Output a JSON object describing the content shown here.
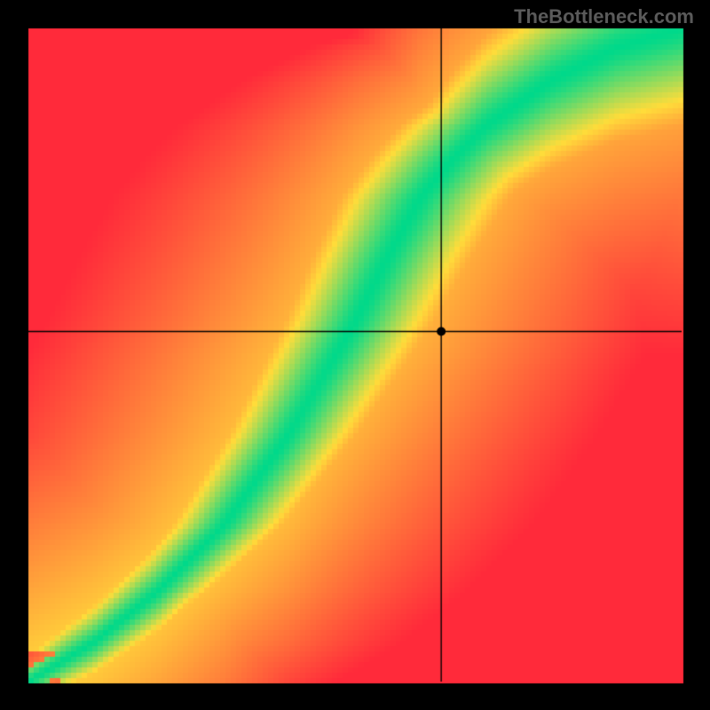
{
  "watermark": "TheBottleneck.com",
  "chart_data": {
    "type": "heatmap",
    "title": "",
    "xlabel": "",
    "ylabel": "",
    "xlim": [
      0,
      1
    ],
    "ylim": [
      0,
      1
    ],
    "crosshair": {
      "x": 0.632,
      "y": 0.536
    },
    "marker": {
      "x": 0.632,
      "y": 0.536
    },
    "ridge_curve": {
      "description": "Monotone curve from lower-left to upper-right where value is maximal (green)",
      "points": [
        [
          0.0,
          0.0
        ],
        [
          0.1,
          0.06
        ],
        [
          0.2,
          0.14
        ],
        [
          0.3,
          0.24
        ],
        [
          0.4,
          0.38
        ],
        [
          0.5,
          0.55
        ],
        [
          0.55,
          0.65
        ],
        [
          0.6,
          0.74
        ],
        [
          0.65,
          0.8
        ],
        [
          0.7,
          0.85
        ],
        [
          0.8,
          0.92
        ],
        [
          0.9,
          0.97
        ],
        [
          1.0,
          1.0
        ]
      ]
    },
    "colormap": {
      "description": "Red-Yellow-Green diverging: red far from ridge, yellow at mid-distance, green on ridge",
      "stops": [
        {
          "t": 0.0,
          "color": "#ff2a3a"
        },
        {
          "t": 0.5,
          "color": "#ffdc3a"
        },
        {
          "t": 1.0,
          "color": "#00d98a"
        }
      ]
    },
    "inner_margin_fraction": 0.04,
    "outer_border_color": "#000000"
  }
}
